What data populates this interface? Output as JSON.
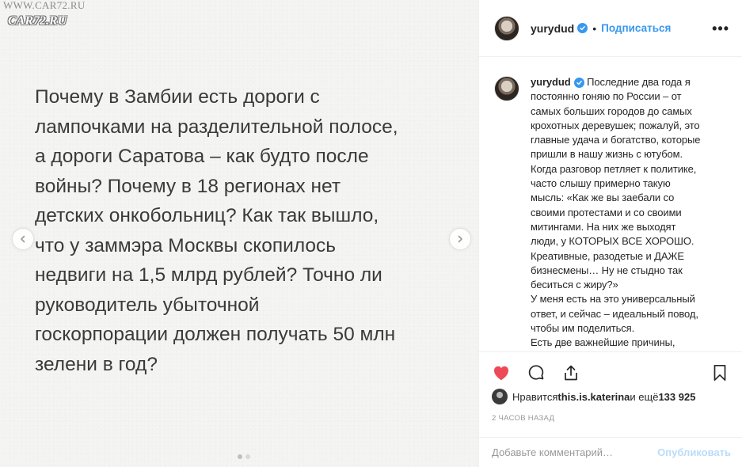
{
  "watermark": {
    "line1": "WWW.CAR72.RU",
    "line2": "CAR72.RU"
  },
  "post_image": {
    "text": "Почему в Замбии есть дороги с\nлампочками на разделительной полосе,\nа дороги Саратова – как будто после\nвойны? Почему в 18 регионах нет\nдетских онкобольниц? Как так вышло,\nчто у заммэра Москвы скопилось\nнедвиги на 1,5 млрд рублей? Точно ли\nруководитель убыточной\nгоскорпорации должен получать 50 млн\nзелени в год?"
  },
  "header": {
    "username": "yurydud",
    "separator": "•",
    "follow_label": "Подписаться",
    "more_label": "•••"
  },
  "caption": {
    "username": "yurydud",
    "lines": [
      "Последние два года я",
      "постоянно гоняю по России – от",
      "самых больших городов до самых",
      "крохотных деревушек; пожалуй, это",
      "главные удача и богатство, которые",
      "пришли в нашу жизнь с ютубом.",
      "Когда разговор петляет к политике,",
      "часто слышу примерно такую",
      "мысль: «Как же вы заебали со",
      "своими протестами и со своими",
      "митингами. На них же выходят",
      "люди, у КОТОРЫХ ВСЕ ХОРОШО.",
      "Креативные, разодетые и ДАЖЕ",
      "бизнесмены… Ну не стыдно так",
      "беситься с жиру?»",
      "У меня есть на это универсальный",
      "ответ, и сейчас – идеальный повод,",
      "чтобы им поделиться.",
      "Есть две важнейшие причины,"
    ]
  },
  "likes": {
    "prefix": "Нравится ",
    "liker": "this.is.katerina",
    "middle": " и ещё ",
    "count": "133 925"
  },
  "timestamp": "2 ЧАСОВ НАЗАД",
  "comment": {
    "placeholder": "Добавьте комментарий…",
    "publish_label": "Опубликовать"
  },
  "colors": {
    "like_red": "#ed4956",
    "link_blue": "#3897f0",
    "publish_disabled": "#b9dcfa"
  }
}
